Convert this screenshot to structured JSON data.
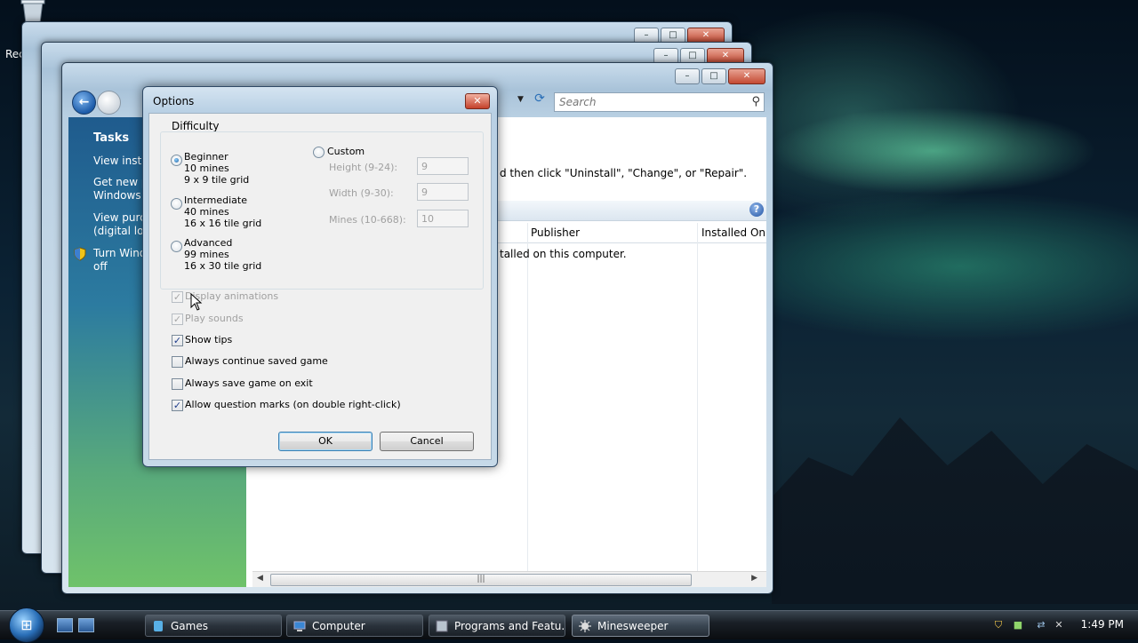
{
  "desktop": {
    "recycle_label": "Rec"
  },
  "bg_windows": {
    "control_buttons": {
      "minimize": "–",
      "maximize": "□",
      "close": "✕"
    }
  },
  "programs_window": {
    "search_placeholder": "Search",
    "sidebar": {
      "title": "Tasks",
      "links": [
        "View instal",
        "Get new p\nWindows M",
        "View purch\n(digital loc",
        "Turn Wind\noff"
      ]
    },
    "hint_text": "d then click \"Uninstall\", \"Change\", or \"Repair\".",
    "columns": [
      "Publisher",
      "Installed On"
    ],
    "empty_message": "talled on this computer."
  },
  "dialog": {
    "title": "Options",
    "difficulty": {
      "label": "Difficulty",
      "levels": [
        {
          "name": "Beginner",
          "mines": "10 mines",
          "grid": "9 x 9 tile grid",
          "selected": true
        },
        {
          "name": "Intermediate",
          "mines": "40 mines",
          "grid": "16 x 16 tile grid",
          "selected": false
        },
        {
          "name": "Advanced",
          "mines": "99 mines",
          "grid": "16 x 30 tile grid",
          "selected": false
        }
      ],
      "custom": {
        "label": "Custom",
        "height_label": "Height (9-24):",
        "height_value": "9",
        "width_label": "Width (9-30):",
        "width_value": "9",
        "mines_label": "Mines (10-668):",
        "mines_value": "10"
      }
    },
    "options": [
      {
        "label": "Display animations",
        "checked": true,
        "disabled": true
      },
      {
        "label": "Play sounds",
        "checked": true,
        "disabled": true
      },
      {
        "label": "Show tips",
        "checked": true,
        "disabled": false
      },
      {
        "label": "Always continue saved game",
        "checked": false,
        "disabled": false
      },
      {
        "label": "Always save game on exit",
        "checked": false,
        "disabled": false
      },
      {
        "label": "Allow question marks (on double right-click)",
        "checked": true,
        "disabled": false
      }
    ],
    "ok_label": "OK",
    "cancel_label": "Cancel"
  },
  "taskbar": {
    "items": [
      {
        "label": "Games",
        "active": false
      },
      {
        "label": "Computer",
        "active": false
      },
      {
        "label": "Programs and Featu...",
        "active": false
      },
      {
        "label": "Minesweeper",
        "active": true
      }
    ],
    "clock": "1:49 PM"
  },
  "colors": {
    "accent": "#1c5ba9",
    "sidebar_top": "#1f5b8d",
    "sidebar_bottom": "#6fc26a"
  }
}
